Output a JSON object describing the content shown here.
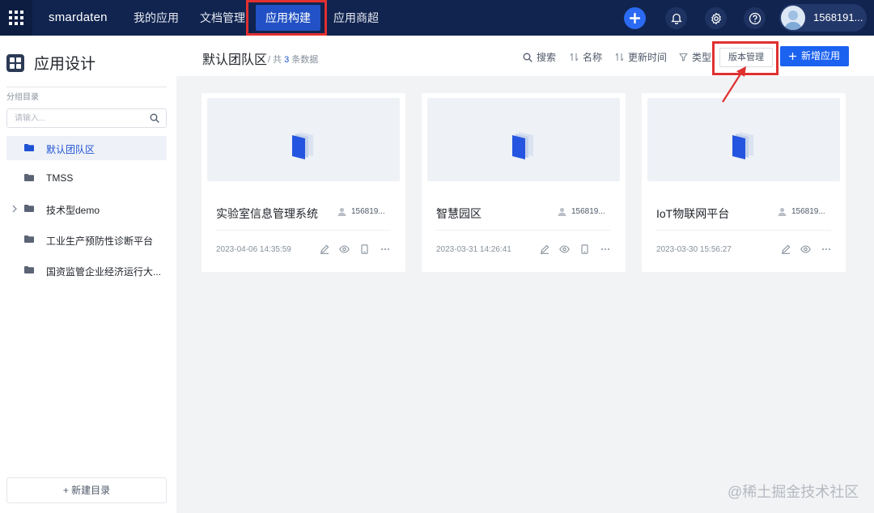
{
  "topbar": {
    "logo_bold": "sm",
    "logo_mid": "ar",
    "logo_end": "daten",
    "nav": [
      "我的应用",
      "文档管理",
      "应用构建",
      "应用商超"
    ],
    "active_nav": "应用构建",
    "username": "1568191..."
  },
  "sidebar": {
    "title": "应用设计",
    "group_label": "分组目录",
    "search_placeholder": "请输入...",
    "items": [
      {
        "label": "默认团队区",
        "selected": true
      },
      {
        "label": "TMSS"
      },
      {
        "label": "技术型demo",
        "expandable": true
      },
      {
        "label": "工业生产预防性诊断平台"
      },
      {
        "label": "国资监管企业经济运行大..."
      }
    ],
    "new_dir_label": "+ 新建目录"
  },
  "header": {
    "title": "默认团队区",
    "count_prefix": "/ 共",
    "count": "3",
    "count_suffix": "条数据",
    "search_label": "搜索",
    "name_label": "名称",
    "update_label": "更新时间",
    "type_label": "类型",
    "version_label": "版本管理",
    "add_label": "新增应用"
  },
  "cards": [
    {
      "name": "实验室信息管理系统",
      "owner": "156819...",
      "time": "2023-04-06 14:35:59",
      "has_mobile": true
    },
    {
      "name": "智慧园区",
      "owner": "156819...",
      "time": "2023-03-31 14:26:41",
      "has_mobile": true
    },
    {
      "name": "IoT物联网平台",
      "owner": "156819...",
      "time": "2023-03-30 15:56:27",
      "has_mobile": false
    }
  ],
  "watermark": "@稀土掘金技术社区",
  "colors": {
    "topbar": "#11244f",
    "accent": "#1b62f0",
    "highlight": "#e03030"
  }
}
